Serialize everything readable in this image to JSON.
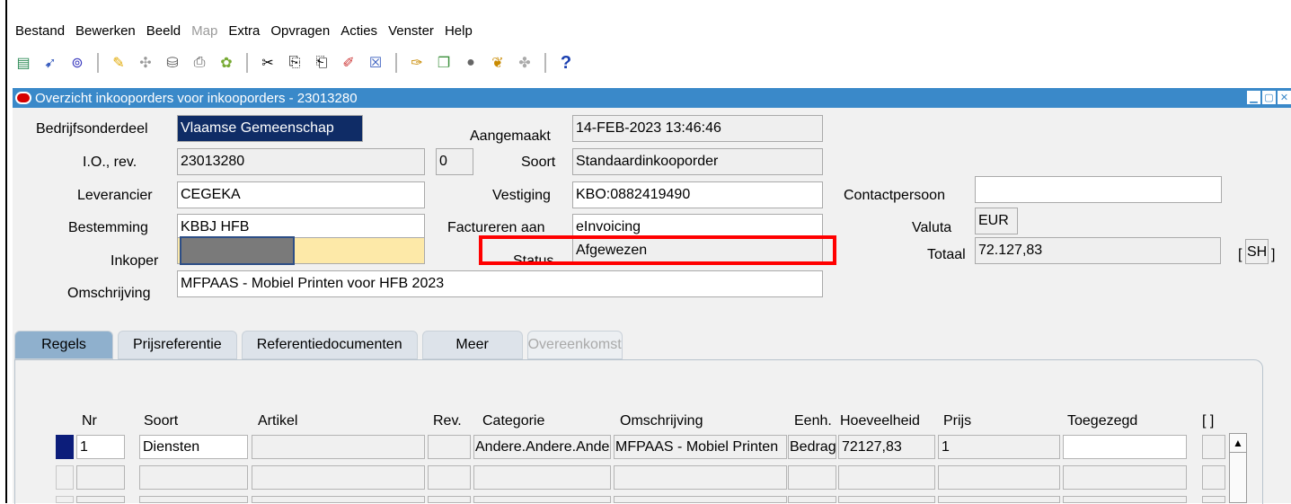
{
  "menu": [
    "Bestand",
    "Bewerken",
    "Beeld",
    "Map",
    "Extra",
    "Opvragen",
    "Acties",
    "Venster",
    "Help"
  ],
  "menu_disabled": [
    "Map"
  ],
  "toolbar_help": "?",
  "window": {
    "title": "Overzicht inkooporders voor inkooporders - 23013280"
  },
  "header": {
    "bedrijfsonderdeel_label": "Bedrijfsonderdeel",
    "bedrijfsonderdeel": "Vlaamse Gemeenschap",
    "io_label": "I.O., rev.",
    "io": "23013280",
    "rev": "0",
    "leverancier_label": "Leverancier",
    "leverancier": "CEGEKA",
    "bestemming_label": "Bestemming",
    "bestemming": "KBBJ HFB",
    "inkoper_label": "Inkoper",
    "inkoper": "",
    "omschrijving_label": "Omschrijving",
    "omschrijving": "MFPAAS - Mobiel Printen voor HFB 2023",
    "aangemaakt_label": "Aangemaakt",
    "aangemaakt": "14-FEB-2023 13:46:46",
    "soort_label": "Soort",
    "soort": "Standaardinkooporder",
    "vestiging_label": "Vestiging",
    "vestiging": "KBO:0882419490",
    "factureren_label": "Factureren aan",
    "factureren": "eInvoicing",
    "status_label": "Status",
    "status": "Afgewezen",
    "contact_label": "Contactpersoon",
    "contact": "",
    "valuta_label": "Valuta",
    "valuta": "EUR",
    "totaal_label": "Totaal",
    "totaal": "72.127,83",
    "bracket_open": "[",
    "bracket_value": "SH",
    "bracket_close": "]"
  },
  "tabs": [
    "Regels",
    "Prijsreferentie",
    "Referentiedocumenten",
    "Meer",
    "Overeenkomst"
  ],
  "columns": [
    "Nr",
    "Soort",
    "Artikel",
    "Rev.",
    "Categorie",
    "Omschrijving",
    "Eenh.",
    "Hoeveelheid",
    "Prijs",
    "Toegezegd",
    "[ ]"
  ],
  "rows": [
    {
      "nr": "1",
      "soort": "Diensten",
      "artikel": "",
      "rev": "",
      "categorie": "Andere.Andere.Andere",
      "omschrijving": "MFPAAS - Mobiel Printen",
      "eenh": "Bedrag",
      "hoeveelheid": "72127,83",
      "prijs": "1",
      "toegezegd": ""
    },
    {
      "nr": "",
      "soort": "",
      "artikel": "",
      "rev": "",
      "categorie": "",
      "omschrijving": "",
      "eenh": "",
      "hoeveelheid": "",
      "prijs": "",
      "toegezegd": ""
    },
    {
      "nr": "",
      "soort": "",
      "artikel": "",
      "rev": "",
      "categorie": "",
      "omschrijving": "",
      "eenh": "",
      "hoeveelheid": "",
      "prijs": "",
      "toegezegd": ""
    }
  ],
  "colors": {
    "title_bar": "#3a89c9",
    "required_field": "#fde9a8",
    "selected_field": "#0f2c66",
    "highlight": "#ff0000",
    "active_tab": "#8fb0cd"
  }
}
